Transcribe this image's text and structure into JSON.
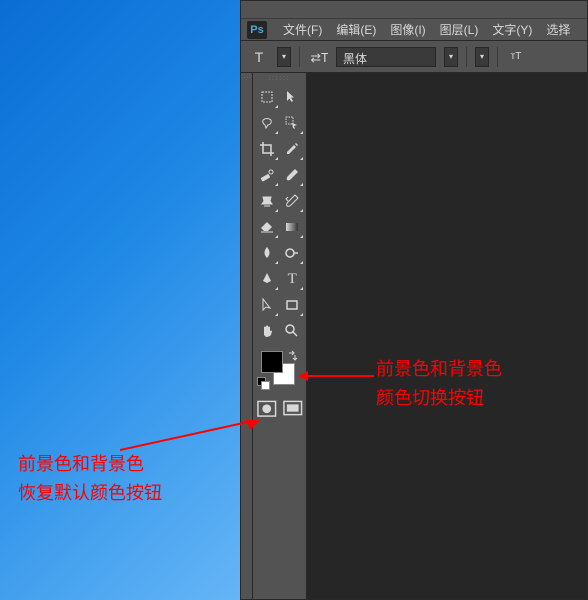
{
  "app": {
    "logo": "Ps"
  },
  "menu": {
    "file": "文件(F)",
    "edit": "编辑(E)",
    "image": "图像(I)",
    "layer": "图层(L)",
    "type": "文字(Y)",
    "select": "选择"
  },
  "options": {
    "font_family": "黑体"
  },
  "colors": {
    "foreground": "#000000",
    "background": "#ffffff"
  },
  "annotations": {
    "swap": "前景色和背景色\n颜色切换按钮",
    "default": "前景色和背景色\n恢复默认颜色按钮"
  }
}
